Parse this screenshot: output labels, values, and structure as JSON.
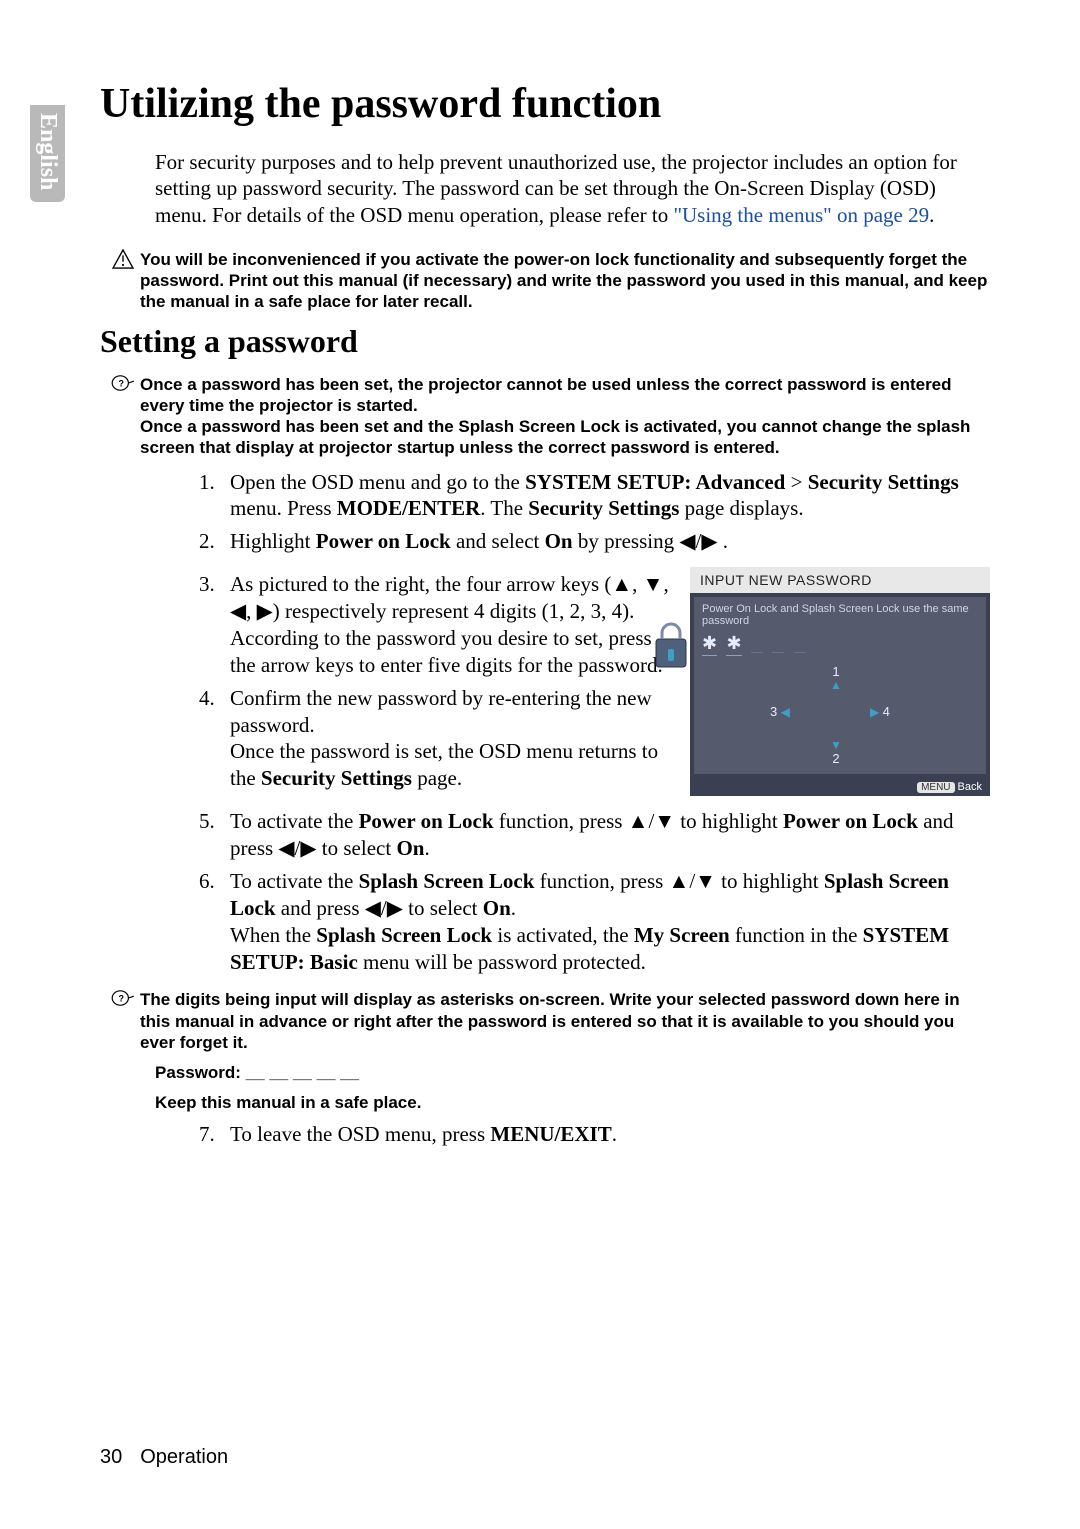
{
  "lang_tab": "English",
  "h1": "Utilizing the password function",
  "intro_1": "For security purposes and to help prevent unauthorized use, the projector includes an option for setting up password security. The password can be set through the On-Screen Display (OSD) menu. For details of the OSD menu operation, please refer to ",
  "intro_link": "\"Using the menus\" on page 29",
  "intro_2": ".",
  "warn_note": "You will be inconvenienced if you activate the power-on lock functionality and subsequently forget the password. Print out this manual (if necessary) and write the password you used in this manual, and keep the manual in a safe place for later recall.",
  "h2": "Setting a password",
  "info_note_1": "Once a password has been set, the projector cannot be used unless the correct password is entered every time the projector is started.",
  "info_note_2": "Once a password has been set and the Splash Screen Lock is activated, you cannot change the splash screen that display at projector startup unless the correct password is entered.",
  "steps": {
    "s1_a": "Open the OSD menu and go to the ",
    "s1_b": "SYSTEM SETUP: Advanced",
    "s1_c": " > ",
    "s1_d": "Security Settings",
    "s1_e": " menu. Press ",
    "s1_f": "MODE/ENTER",
    "s1_g": ". The ",
    "s1_h": "Security Settings",
    "s1_i": " page displays.",
    "s2_a": "Highlight ",
    "s2_b": "Power on Lock",
    "s2_c": " and select ",
    "s2_d": "On",
    "s2_e": " by pressing ◀/▶ .",
    "s3": "As pictured to the right, the four arrow keys (▲, ▼, ◀, ▶) respectively represent 4 digits (1, 2, 3, 4). According to the password you desire to set, press the arrow keys to enter five digits for the password.",
    "s4_a": "Confirm the new password by re-entering the new password.",
    "s4_b": "Once the password is set, the OSD menu returns to the ",
    "s4_c": "Security Settings",
    "s4_d": " page.",
    "s5_a": "To activate the ",
    "s5_b": "Power on Lock",
    "s5_c": " function, press ▲/▼ to highlight ",
    "s5_d": "Power on Lock",
    "s5_e": " and press ◀/▶ to select ",
    "s5_f": "On",
    "s5_g": ".",
    "s6_a": "To activate the ",
    "s6_b": "Splash Screen Lock",
    "s6_c": " function, press ▲/▼ to highlight ",
    "s6_d": "Splash Screen Lock",
    "s6_e": " and press ◀/▶ to select ",
    "s6_f": "On",
    "s6_g": ".",
    "s6_h": "When the ",
    "s6_i": "Splash Screen Lock",
    "s6_j": " is activated, the ",
    "s6_k": "My Screen",
    "s6_l": " function in the ",
    "s6_m": "SYSTEM SETUP: Basic",
    "s6_n": " menu will be password protected.",
    "s7_a": "To leave the OSD menu, press ",
    "s7_b": "MENU/EXIT",
    "s7_c": "."
  },
  "info_note_3": "The digits being input will display as asterisks on-screen. Write your selected password down here in this manual in advance or right after the password is entered so that it is available to you should you ever forget it.",
  "pw_label": "Password: __ __ __ __ __",
  "pw_keep": "Keep this manual in a safe place.",
  "osd": {
    "title": "INPUT NEW PASSWORD",
    "hint": "Power On Lock and Splash Screen Lock use the same password",
    "n_up": "1",
    "n_down": "2",
    "n_left": "3",
    "n_right": "4",
    "menu_btn": "MENU",
    "back": "Back"
  },
  "footer": {
    "page": "30",
    "section": "Operation"
  }
}
